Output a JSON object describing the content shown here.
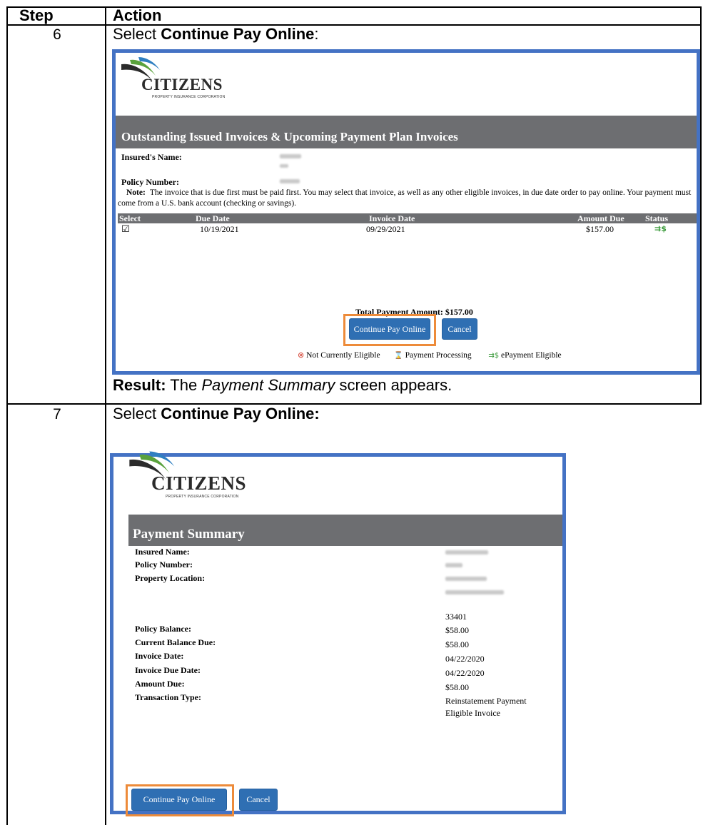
{
  "table": {
    "header_step": "Step",
    "header_action": "Action"
  },
  "step6": {
    "number": "6",
    "instruction_prefix": "Select ",
    "instruction_bold": "Continue Pay Online",
    "instruction_suffix": ":",
    "result_label": "Result:",
    "result_pre": " The ",
    "result_italic": "Payment Summary",
    "result_post": " screen appears.",
    "screen": {
      "logo_word": "CITIZENS",
      "logo_sub": "PROPERTY INSURANCE CORPORATION",
      "title": "Outstanding Issued Invoices & Upcoming Payment Plan Invoices",
      "insured_name_label": "Insured's Name:",
      "policy_number_label": "Policy Number:",
      "note_label": "Note:",
      "note_text": "The invoice that is due first must be paid first. You may select that invoice, as well as any other eligible invoices, in due date order to pay online. Your payment must",
      "note_text2": "come from a U.S. bank account (checking or savings).",
      "columns": [
        "Select",
        "Due Date",
        "Invoice Date",
        "Amount Due",
        "Status"
      ],
      "row": {
        "checkbox": "☑",
        "due_date": "10/19/2021",
        "invoice_date": "09/29/2021",
        "amount_due": "$157.00",
        "status": "⇉$"
      },
      "total_label": "Total Payment Amount:",
      "total_value": "$157.00",
      "continue_button": "Continue Pay Online",
      "cancel_button": "Cancel",
      "legend": {
        "not_eligible_icon": "⊗",
        "not_eligible": "Not Currently Eligible",
        "processing_icon": "⌛",
        "processing": "Payment Processing",
        "eligible_icon": "⇉$",
        "eligible": "ePayment Eligible"
      }
    }
  },
  "step7": {
    "number": "7",
    "instruction_prefix": "Select ",
    "instruction_bold": "Continue Pay Online:",
    "screen": {
      "logo_word": "CITIZENS",
      "logo_sub": "PROPERTY INSURANCE CORPORATION",
      "title": "Payment Summary",
      "labels": {
        "insured_name": "Insured Name:",
        "policy_number": "Policy Number:",
        "property_location": "Property Location:",
        "policy_balance": "Policy Balance:",
        "current_balance_due": "Current Balance Due:",
        "invoice_date": "Invoice Date:",
        "invoice_due_date": "Invoice Due Date:",
        "amount_due": "Amount Due:",
        "transaction_type": "Transaction Type:"
      },
      "values": {
        "zip": "33401",
        "policy_balance": "$58.00",
        "current_balance_due": "$58.00",
        "invoice_date": "04/22/2020",
        "invoice_due_date": "04/22/2020",
        "amount_due": "$58.00",
        "transaction_type_line1": "Reinstatement Payment",
        "transaction_type_line2": "Eligible Invoice"
      },
      "continue_button": "Continue Pay Online",
      "cancel_button": "Cancel"
    }
  },
  "colors": {
    "frame_blue": "#4472c4",
    "highlight_orange": "#ed8b3a",
    "band_gray": "#6d6e71",
    "button_blue": "#2f6fb3",
    "eligible_green": "#3a9a3a"
  }
}
